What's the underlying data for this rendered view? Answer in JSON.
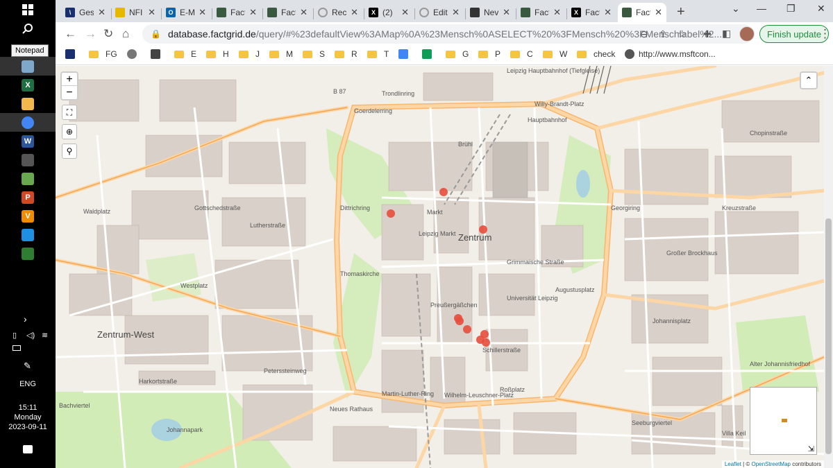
{
  "taskbar": {
    "tooltip": "Notepad",
    "language": "ENG",
    "time": "15:11",
    "day": "Monday",
    "date": "2023-09-11",
    "apps": [
      {
        "name": "notepad",
        "icon": "notepad-icon",
        "color": "#7fa7c9",
        "glyph": ""
      },
      {
        "name": "excel",
        "icon": "excel-icon",
        "color": "#1d6f42",
        "glyph": "X"
      },
      {
        "name": "file-explorer",
        "icon": "folder-icon",
        "color": "#f2b84b",
        "glyph": ""
      },
      {
        "name": "chrome",
        "icon": "chrome-icon",
        "color": "#4285f4",
        "glyph": ""
      },
      {
        "name": "word",
        "icon": "word-icon",
        "color": "#2b579a",
        "glyph": "W"
      },
      {
        "name": "paint",
        "icon": "paint-icon",
        "color": "#555555",
        "glyph": ""
      },
      {
        "name": "paint-palette",
        "icon": "palette-icon",
        "color": "#6aa84f",
        "glyph": ""
      },
      {
        "name": "powerpoint",
        "icon": "powerpoint-icon",
        "color": "#d24726",
        "glyph": "P"
      },
      {
        "name": "vlc",
        "icon": "vlc-icon",
        "color": "#f08c00",
        "glyph": "V"
      },
      {
        "name": "edge",
        "icon": "edge-icon",
        "color": "#1f8fe1",
        "glyph": ""
      },
      {
        "name": "app-store",
        "icon": "store-icon",
        "color": "#2e7d32",
        "glyph": ""
      }
    ]
  },
  "browser": {
    "tabs": [
      {
        "title": "Ges",
        "icon": "factgrid-icon",
        "color": "#1a2f6e",
        "glyph": "\\"
      },
      {
        "title": "NFI",
        "icon": "key-icon",
        "color": "#e6b800",
        "glyph": ""
      },
      {
        "title": "E-M",
        "icon": "outlook-icon",
        "color": "#0a64ad",
        "glyph": "O"
      },
      {
        "title": "Fact",
        "icon": "factgrid-icon",
        "color": "#3a5a40",
        "glyph": ""
      },
      {
        "title": "Fact",
        "icon": "factgrid-icon",
        "color": "#3a5a40",
        "glyph": ""
      },
      {
        "title": "Rec",
        "icon": "loading-icon",
        "color": "#999999",
        "glyph": ""
      },
      {
        "title": "(2)",
        "icon": "x-icon",
        "color": "#000000",
        "glyph": "X"
      },
      {
        "title": "Edit",
        "icon": "loading-icon",
        "color": "#999999",
        "glyph": ""
      },
      {
        "title": "Nev",
        "icon": "github-icon",
        "color": "#333333",
        "glyph": ""
      },
      {
        "title": "Fact",
        "icon": "factgrid-icon",
        "color": "#3a5a40",
        "glyph": ""
      },
      {
        "title": "Fact",
        "icon": "x-icon",
        "color": "#000000",
        "glyph": "X"
      },
      {
        "title": "Fact",
        "icon": "factgrid-icon",
        "color": "#3a5a40",
        "glyph": ""
      }
    ],
    "active_tab": 11,
    "url_host": "database.factgrid.de",
    "url_path": "/query/#%23defaultView%3AMap%0A%23Mensch%0ASELECT%20%3FMensch%20%3FMenschlabel%2...",
    "finish_update": "Finish update",
    "bookmarks": [
      {
        "label": "",
        "type": "icon",
        "icon": "factgrid-icon",
        "color": "#1a2f6e"
      },
      {
        "label": "FG",
        "type": "folder"
      },
      {
        "label": "",
        "type": "icon",
        "icon": "loading-icon",
        "color": "#777777"
      },
      {
        "label": "",
        "type": "icon",
        "icon": "barcode-icon",
        "color": "#444444"
      },
      {
        "label": "E",
        "type": "folder"
      },
      {
        "label": "H",
        "type": "folder"
      },
      {
        "label": "J",
        "type": "folder"
      },
      {
        "label": "M",
        "type": "folder"
      },
      {
        "label": "S",
        "type": "folder"
      },
      {
        "label": "R",
        "type": "folder"
      },
      {
        "label": "T",
        "type": "folder"
      },
      {
        "label": "",
        "type": "icon",
        "icon": "docs-icon",
        "color": "#4285f4"
      },
      {
        "label": "",
        "type": "icon",
        "icon": "sheets-icon",
        "color": "#0f9d58"
      },
      {
        "label": "G",
        "type": "folder"
      },
      {
        "label": "P",
        "type": "folder"
      },
      {
        "label": "C",
        "type": "folder"
      },
      {
        "label": "W",
        "type": "folder"
      },
      {
        "label": "check",
        "type": "folder"
      },
      {
        "label": "http://www.msftcon...",
        "type": "icon",
        "icon": "globe-icon",
        "color": "#555555"
      }
    ]
  },
  "map": {
    "labels": [
      {
        "text": "Zentrum",
        "cls": "big"
      },
      {
        "text": "Zentrum-West",
        "cls": "big"
      },
      {
        "text": "Leipzig Hauptbahnhof (Tiefgleise)",
        "cls": ""
      },
      {
        "text": "Hauptbahnhof",
        "cls": ""
      },
      {
        "text": "Trondlinring",
        "cls": ""
      },
      {
        "text": "Willy-Brandt-Platz",
        "cls": ""
      },
      {
        "text": "Brühl",
        "cls": ""
      },
      {
        "text": "Leipzig Markt",
        "cls": ""
      },
      {
        "text": "Markt",
        "cls": ""
      },
      {
        "text": "Thomaskirche",
        "cls": ""
      },
      {
        "text": "Grimmaische Straße",
        "cls": ""
      },
      {
        "text": "Augustusplatz",
        "cls": ""
      },
      {
        "text": "Universität Leipzig",
        "cls": ""
      },
      {
        "text": "Johannisplatz",
        "cls": ""
      },
      {
        "text": "Alter Johannisfriedhof",
        "cls": ""
      },
      {
        "text": "Roßplatz",
        "cls": ""
      },
      {
        "text": "Wilhelm-Leuschner-Platz",
        "cls": ""
      },
      {
        "text": "Neues Rathaus",
        "cls": ""
      },
      {
        "text": "Martin-Luther-Ring",
        "cls": ""
      },
      {
        "text": "Goerdelerring",
        "cls": ""
      },
      {
        "text": "Dittrichring",
        "cls": ""
      },
      {
        "text": "Georgiring",
        "cls": ""
      },
      {
        "text": "Johannapark",
        "cls": ""
      },
      {
        "text": "Bachviertel",
        "cls": ""
      },
      {
        "text": "Westplatz",
        "cls": ""
      },
      {
        "text": "Waldplatz",
        "cls": ""
      },
      {
        "text": "Gottschedstraße",
        "cls": ""
      },
      {
        "text": "Harkortstraße",
        "cls": ""
      },
      {
        "text": "Peterssteinweg",
        "cls": ""
      },
      {
        "text": "Seeburgviertel",
        "cls": ""
      },
      {
        "text": "Großer Brockhaus",
        "cls": ""
      },
      {
        "text": "Kreuzstraße",
        "cls": ""
      },
      {
        "text": "Chopinstraße",
        "cls": ""
      },
      {
        "text": "Lutherstraße",
        "cls": ""
      },
      {
        "text": "Schillerstraße",
        "cls": ""
      },
      {
        "text": "Preußergäßchen",
        "cls": ""
      },
      {
        "text": "Villa Keil",
        "cls": ""
      },
      {
        "text": "B 87",
        "cls": ""
      }
    ],
    "markers_color": "#e74c3c",
    "attribution_leaflet": "Leaflet",
    "attribution_osm": "OpenStreetMap",
    "attribution_suffix": "contributors",
    "zoom_in": "+",
    "zoom_out": "−"
  }
}
